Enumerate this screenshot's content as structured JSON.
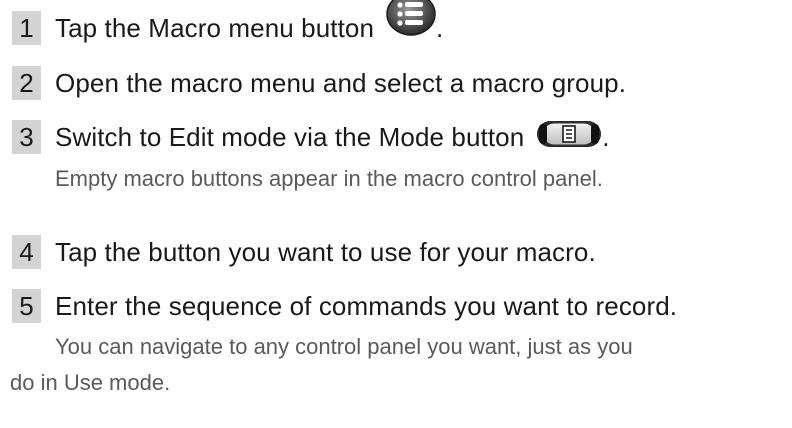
{
  "steps": [
    {
      "number": "1",
      "text": "Tap the Macro menu button",
      "suffix": ".",
      "icon": "macro-menu-icon"
    },
    {
      "number": "2",
      "text": "Open the macro menu and select a macro group."
    },
    {
      "number": "3",
      "text": "Switch to Edit mode via the Mode button",
      "suffix": ".",
      "icon": "mode-button-icon",
      "note": "Empty macro buttons appear in the macro control panel."
    },
    {
      "number": "4",
      "text": "Tap the button you want to use for your macro."
    },
    {
      "number": "5",
      "text": "Enter the sequence of commands you want to record.",
      "note_lines": [
        "You can navigate to any control panel you want, just as you",
        "do in Use mode."
      ]
    }
  ]
}
